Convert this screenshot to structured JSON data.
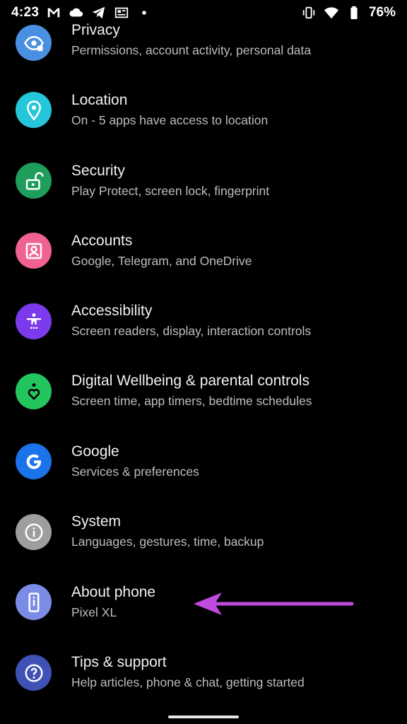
{
  "status_bar": {
    "time": "4:23",
    "battery": "76%",
    "notification_icons": [
      "gmail-icon",
      "cloud-icon",
      "telegram-icon",
      "news-icon",
      "dot-icon"
    ],
    "system_icons": [
      "vibrate-icon",
      "wifi-icon",
      "battery-icon"
    ]
  },
  "settings": {
    "items": [
      {
        "id": "privacy",
        "title": "Privacy",
        "subtitle": "Permissions, account activity, personal data",
        "color": "#4a90e2",
        "icon": "privacy-eye-icon"
      },
      {
        "id": "location",
        "title": "Location",
        "subtitle": "On - 5 apps have access to location",
        "color": "#26c6da",
        "icon": "location-pin-icon"
      },
      {
        "id": "security",
        "title": "Security",
        "subtitle": "Play Protect, screen lock, fingerprint",
        "color": "#1e9e5a",
        "icon": "unlock-icon"
      },
      {
        "id": "accounts",
        "title": "Accounts",
        "subtitle": "Google, Telegram, and OneDrive",
        "color": "#f06292",
        "icon": "account-box-icon"
      },
      {
        "id": "accessibility",
        "title": "Accessibility",
        "subtitle": "Screen readers, display, interaction controls",
        "color": "#7c3aed",
        "icon": "accessibility-person-icon"
      },
      {
        "id": "digital-wellbeing",
        "title": "Digital Wellbeing & parental controls",
        "subtitle": "Screen time, app timers, bedtime schedules",
        "color": "#22c55e",
        "icon": "wellbeing-heart-icon"
      },
      {
        "id": "google",
        "title": "Google",
        "subtitle": "Services & preferences",
        "color": "#1a73e8",
        "icon": "google-g-icon"
      },
      {
        "id": "system",
        "title": "System",
        "subtitle": "Languages, gestures, time, backup",
        "color": "#9e9e9e",
        "icon": "info-icon"
      },
      {
        "id": "about-phone",
        "title": "About phone",
        "subtitle": "Pixel XL",
        "color": "#7b8ce6",
        "icon": "phone-info-icon"
      },
      {
        "id": "tips-support",
        "title": "Tips & support",
        "subtitle": "Help articles, phone & chat, getting started",
        "color": "#3f51b5",
        "icon": "help-question-icon"
      }
    ]
  },
  "annotation": {
    "arrow_color": "#c04be0"
  }
}
